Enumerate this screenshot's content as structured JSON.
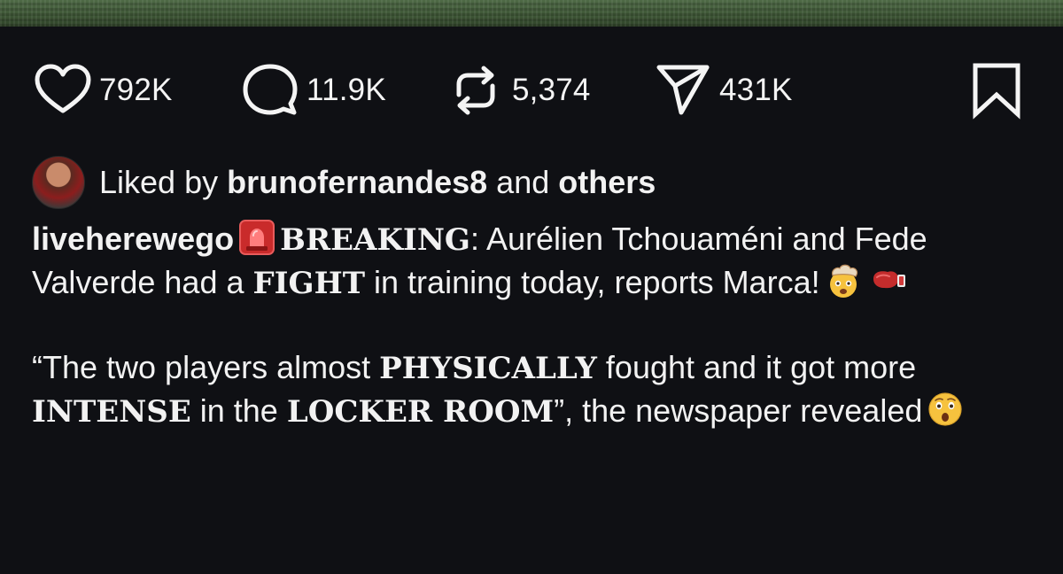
{
  "actions": {
    "likes": "792K",
    "comments": "11.9K",
    "reposts": "5,374",
    "shares": "431K",
    "icons": [
      "heart-icon",
      "comment-icon",
      "repost-icon",
      "share-icon",
      "bookmark-icon"
    ]
  },
  "liked_by": {
    "prefix": "Liked by",
    "user": "brunofernandes8",
    "middle": "and",
    "others": "others"
  },
  "caption": {
    "username": "liveherewego",
    "breaking": "BREAKING",
    "text_1": ": Aurélien Tchouaméni and Fede Valverde had a ",
    "fight": "FIGHT",
    "text_2": " in training today, reports Marca!",
    "quote_1": "“The two players almost ",
    "physically": "PHYSICALLY",
    "quote_2": " fought and it got more ",
    "intense": "INTENSE",
    "quote_3": " in the ",
    "locker_room": "LOCKER ROOM",
    "quote_4": "”, the newspaper revealed"
  },
  "colors": {
    "background": "#0f1014",
    "text": "#f2f2f2",
    "grass": "#3d5535"
  }
}
